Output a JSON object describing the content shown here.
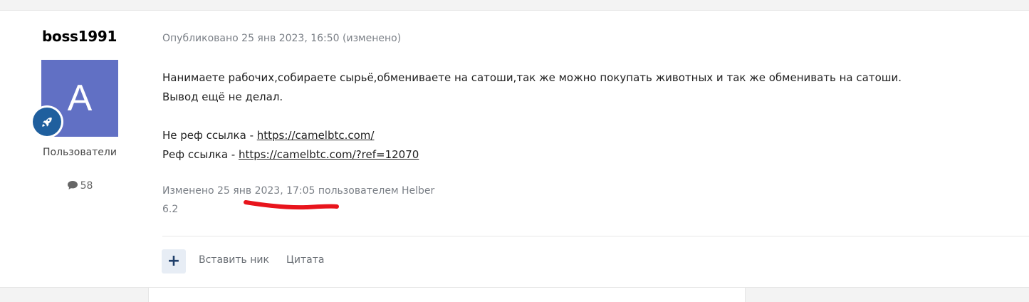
{
  "author": {
    "name": "boss1991",
    "avatar_letter": "A",
    "avatar_color": "#6170c4",
    "rank_icon": "rocket-icon",
    "group": "Пользователи",
    "post_count": "58"
  },
  "post": {
    "meta": "Опубликовано 25 янв 2023, 16:50 (изменено)",
    "line1": "Нанимаете рабочих,собираете сырьё,обмениваете на сатоши,так же можно покупать животных и так же обменивать на сатоши.",
    "line2": "Вывод ещё не делал.",
    "nonref_label": "Не реф ссылка - ",
    "nonref_link": "https://camelbtc.com/",
    "ref_label": "Реф ссылка - ",
    "ref_link": "https://camelbtc.com/?ref=12070",
    "edited": "Изменено 25 янв 2023, 17:05 пользователем Helber",
    "signature": "6.2"
  },
  "actions": {
    "plus": "+",
    "mention": "Вставить ник",
    "quote": "Цитата"
  },
  "colors": {
    "accent": "#1f5f9e",
    "highlight_mark": "#e8141c"
  }
}
